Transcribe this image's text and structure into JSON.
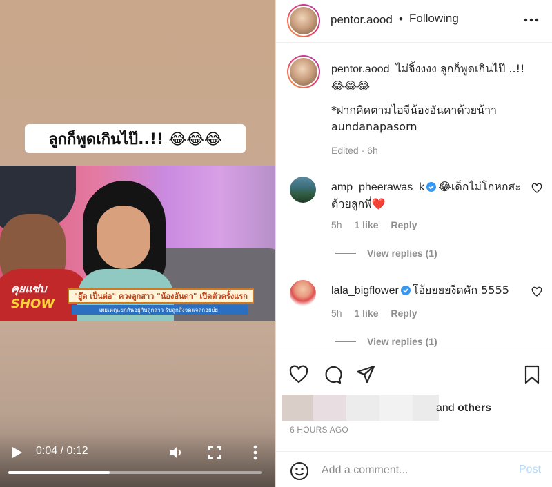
{
  "video": {
    "caption_overlay": "ลูกก็พูดเกินไป๊..!! 😂😂😂",
    "show_logo_top": "คุยแซ่บ",
    "show_logo_bottom": "SHOW",
    "banner_title": "\"อู๊ด เป็นต่อ\" ควงลูกสาว \"น้องอันดา\" เปิดตัวครั้งแรก",
    "banner_sub": "เผยเหตุแยกกันอยู่กับลูกสาว รับลูกสิ่งจดแจลกอยย้ย!",
    "time_display": "0:04 / 0:12",
    "progress": 0.4
  },
  "header": {
    "username": "pentor.aood",
    "separator": "•",
    "follow_status": "Following"
  },
  "caption": {
    "username": "pentor.aood",
    "text": "ไม่จิ้งงงง ลูกก็พูดเกินไป๊ ..!! 😂😂😂",
    "line2": "*ฝากคิดตามไอจีน้องอันดาด้วยน้าา",
    "line3": "aundanapasorn",
    "edited": "Edited",
    "dot": "·",
    "age": "6h"
  },
  "comments": [
    {
      "username": "amp_pheerawas_k",
      "text": "😂เด็กไม่โกหกสะด้วยลูกพี่❤️",
      "age": "5h",
      "likes": "1 like",
      "reply": "Reply",
      "view_replies": "View replies (1)"
    },
    {
      "username": "lala_bigflower",
      "text": "โอ้ยยยยงีดคัก 5555",
      "age": "5h",
      "likes": "1 like",
      "reply": "Reply",
      "view_replies": "View replies (1)"
    }
  ],
  "likes": {
    "and": "and",
    "others": "others"
  },
  "timestamp": "6 HOURS AGO",
  "add_comment": {
    "placeholder": "Add a comment...",
    "post": "Post"
  },
  "colors": {
    "verified": "#3897f0",
    "post_disabled": "#b3dbff",
    "muted": "#8e8e8e"
  }
}
